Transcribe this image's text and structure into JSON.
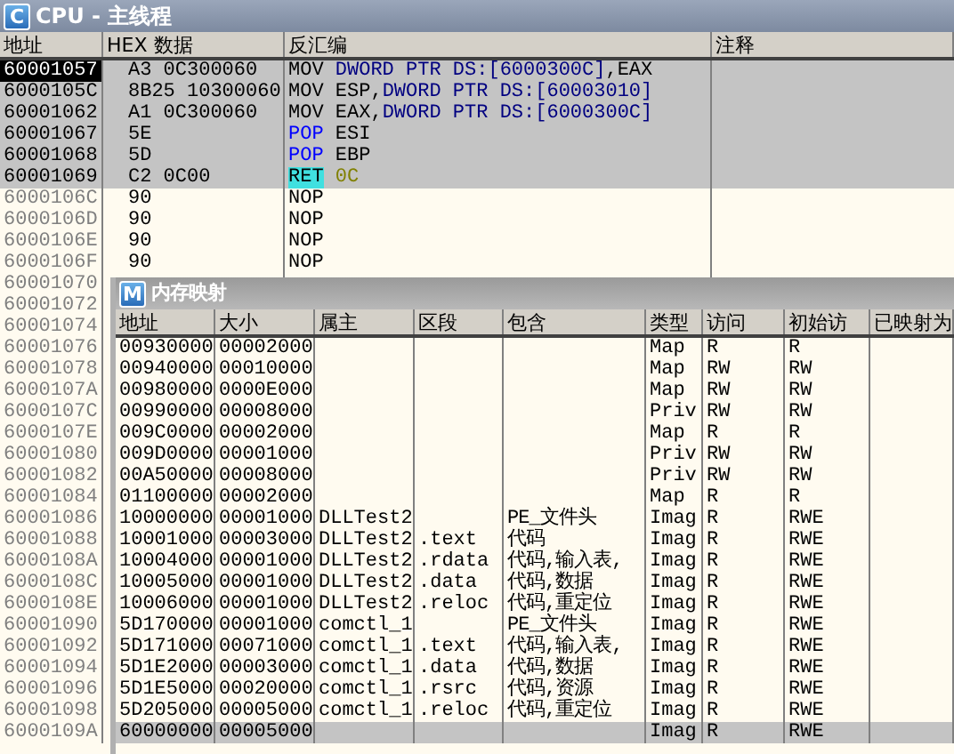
{
  "cpu_window": {
    "title": "CPU - 主线程",
    "icon_letter": "C",
    "columns": [
      "地址",
      "HEX 数据",
      "反汇编",
      "注释"
    ],
    "rows": [
      {
        "address": "60001057",
        "selected": true,
        "highlighted": true,
        "hex": "A3 0C300060",
        "disasm": [
          {
            "text": "MOV ",
            "kind": "plain"
          },
          {
            "text": "DWORD PTR DS:[6000300C]",
            "kind": "mem"
          },
          {
            "text": ",EAX",
            "kind": "plain"
          }
        ]
      },
      {
        "address": "6000105C",
        "selected": false,
        "highlighted": true,
        "hex": "8B25 10300060",
        "disasm": [
          {
            "text": "MOV ESP,",
            "kind": "plain"
          },
          {
            "text": "DWORD PTR DS:[60003010]",
            "kind": "mem"
          }
        ]
      },
      {
        "address": "60001062",
        "selected": false,
        "highlighted": true,
        "hex": "A1 0C300060",
        "disasm": [
          {
            "text": "MOV EAX,",
            "kind": "plain"
          },
          {
            "text": "DWORD PTR DS:[6000300C]",
            "kind": "mem"
          }
        ]
      },
      {
        "address": "60001067",
        "selected": false,
        "highlighted": true,
        "hex": "5E",
        "disasm": [
          {
            "text": "POP",
            "kind": "stack"
          },
          {
            "text": " ESI",
            "kind": "plain"
          }
        ]
      },
      {
        "address": "60001068",
        "selected": false,
        "highlighted": true,
        "hex": "5D",
        "disasm": [
          {
            "text": "POP",
            "kind": "stack"
          },
          {
            "text": " EBP",
            "kind": "plain"
          }
        ]
      },
      {
        "address": "60001069",
        "selected": false,
        "highlighted": true,
        "hex": "C2 0C00",
        "disasm": [
          {
            "text": "RET",
            "kind": "ret"
          },
          {
            "text": " 0C",
            "kind": "const"
          }
        ]
      },
      {
        "address": "6000106C",
        "selected": false,
        "highlighted": false,
        "hex": "90",
        "disasm": [
          {
            "text": "NOP",
            "kind": "plain"
          }
        ]
      },
      {
        "address": "6000106D",
        "selected": false,
        "highlighted": false,
        "hex": "90",
        "disasm": [
          {
            "text": "NOP",
            "kind": "plain"
          }
        ]
      },
      {
        "address": "6000106E",
        "selected": false,
        "highlighted": false,
        "hex": "90",
        "disasm": [
          {
            "text": "NOP",
            "kind": "plain"
          }
        ]
      },
      {
        "address": "6000106F",
        "selected": false,
        "highlighted": false,
        "hex": "90",
        "disasm": [
          {
            "text": "NOP",
            "kind": "plain"
          }
        ]
      },
      {
        "address": "60001070",
        "selected": false,
        "highlighted": false
      },
      {
        "address": "60001072",
        "selected": false,
        "highlighted": false
      },
      {
        "address": "60001074",
        "selected": false,
        "highlighted": false
      },
      {
        "address": "60001076",
        "selected": false,
        "highlighted": false
      },
      {
        "address": "60001078",
        "selected": false,
        "highlighted": false
      },
      {
        "address": "6000107A",
        "selected": false,
        "highlighted": false
      },
      {
        "address": "6000107C",
        "selected": false,
        "highlighted": false
      },
      {
        "address": "6000107E",
        "selected": false,
        "highlighted": false
      },
      {
        "address": "60001080",
        "selected": false,
        "highlighted": false
      },
      {
        "address": "60001082",
        "selected": false,
        "highlighted": false
      },
      {
        "address": "60001084",
        "selected": false,
        "highlighted": false
      },
      {
        "address": "60001086",
        "selected": false,
        "highlighted": false
      },
      {
        "address": "60001088",
        "selected": false,
        "highlighted": false
      },
      {
        "address": "6000108A",
        "selected": false,
        "highlighted": false
      },
      {
        "address": "6000108C",
        "selected": false,
        "highlighted": false
      },
      {
        "address": "6000108E",
        "selected": false,
        "highlighted": false
      },
      {
        "address": "60001090",
        "selected": false,
        "highlighted": false
      },
      {
        "address": "60001092",
        "selected": false,
        "highlighted": false
      },
      {
        "address": "60001094",
        "selected": false,
        "highlighted": false
      },
      {
        "address": "60001096",
        "selected": false,
        "highlighted": false
      },
      {
        "address": "60001098",
        "selected": false,
        "highlighted": false
      },
      {
        "address": "6000109A",
        "selected": false,
        "highlighted": false
      }
    ]
  },
  "memory_map_window": {
    "title": "内存映射",
    "icon_letter": "M",
    "columns": [
      "地址",
      "大小",
      "属主",
      "区段",
      "包含",
      "类型",
      "访问",
      "初始访",
      "已映射为"
    ],
    "rows": [
      {
        "selected": false,
        "cells": [
          "00930000",
          "00002000",
          "",
          "",
          "",
          "Map",
          "R",
          "R",
          ""
        ]
      },
      {
        "selected": false,
        "cells": [
          "00940000",
          "00010000",
          "",
          "",
          "",
          "Map",
          "RW",
          "RW",
          ""
        ]
      },
      {
        "selected": false,
        "cells": [
          "00980000",
          "0000E000",
          "",
          "",
          "",
          "Map",
          "RW",
          "RW",
          ""
        ]
      },
      {
        "selected": false,
        "cells": [
          "00990000",
          "00008000",
          "",
          "",
          "",
          "Priv",
          "RW",
          "RW",
          ""
        ]
      },
      {
        "selected": false,
        "cells": [
          "009C0000",
          "00002000",
          "",
          "",
          "",
          "Map",
          "R",
          "R",
          ""
        ]
      },
      {
        "selected": false,
        "cells": [
          "009D0000",
          "00001000",
          "",
          "",
          "",
          "Priv",
          "RW",
          "RW",
          ""
        ]
      },
      {
        "selected": false,
        "cells": [
          "00A50000",
          "00008000",
          "",
          "",
          "",
          "Priv",
          "RW",
          "RW",
          ""
        ]
      },
      {
        "selected": false,
        "cells": [
          "01100000",
          "00002000",
          "",
          "",
          "",
          "Map",
          "R",
          "R",
          ""
        ]
      },
      {
        "selected": false,
        "cells": [
          "10000000",
          "00001000",
          "DLLTest2",
          "",
          "PE_文件头",
          "Imag",
          "R",
          "RWE",
          ""
        ]
      },
      {
        "selected": false,
        "cells": [
          "10001000",
          "00003000",
          "DLLTest2",
          ".text",
          "代码",
          "Imag",
          "R",
          "RWE",
          ""
        ]
      },
      {
        "selected": false,
        "cells": [
          "10004000",
          "00001000",
          "DLLTest2",
          ".rdata",
          "代码,输入表,",
          "Imag",
          "R",
          "RWE",
          ""
        ]
      },
      {
        "selected": false,
        "cells": [
          "10005000",
          "00001000",
          "DLLTest2",
          ".data",
          "代码,数据",
          "Imag",
          "R",
          "RWE",
          ""
        ]
      },
      {
        "selected": false,
        "cells": [
          "10006000",
          "00001000",
          "DLLTest2",
          ".reloc",
          "代码,重定位",
          "Imag",
          "R",
          "RWE",
          ""
        ]
      },
      {
        "selected": false,
        "cells": [
          "5D170000",
          "00001000",
          "comctl_1",
          "",
          "PE_文件头",
          "Imag",
          "R",
          "RWE",
          ""
        ]
      },
      {
        "selected": false,
        "cells": [
          "5D171000",
          "00071000",
          "comctl_1",
          ".text",
          "代码,输入表,",
          "Imag",
          "R",
          "RWE",
          ""
        ]
      },
      {
        "selected": false,
        "cells": [
          "5D1E2000",
          "00003000",
          "comctl_1",
          ".data",
          "代码,数据",
          "Imag",
          "R",
          "RWE",
          ""
        ]
      },
      {
        "selected": false,
        "cells": [
          "5D1E5000",
          "00020000",
          "comctl_1",
          ".rsrc",
          "代码,资源",
          "Imag",
          "R",
          "RWE",
          ""
        ]
      },
      {
        "selected": false,
        "cells": [
          "5D205000",
          "00005000",
          "comctl_1",
          ".reloc",
          "代码,重定位",
          "Imag",
          "R",
          "RWE",
          ""
        ]
      },
      {
        "selected": true,
        "cells": [
          "60000000",
          "00005000",
          "",
          "",
          "",
          "Imag",
          "R",
          "RWE",
          ""
        ]
      }
    ]
  }
}
